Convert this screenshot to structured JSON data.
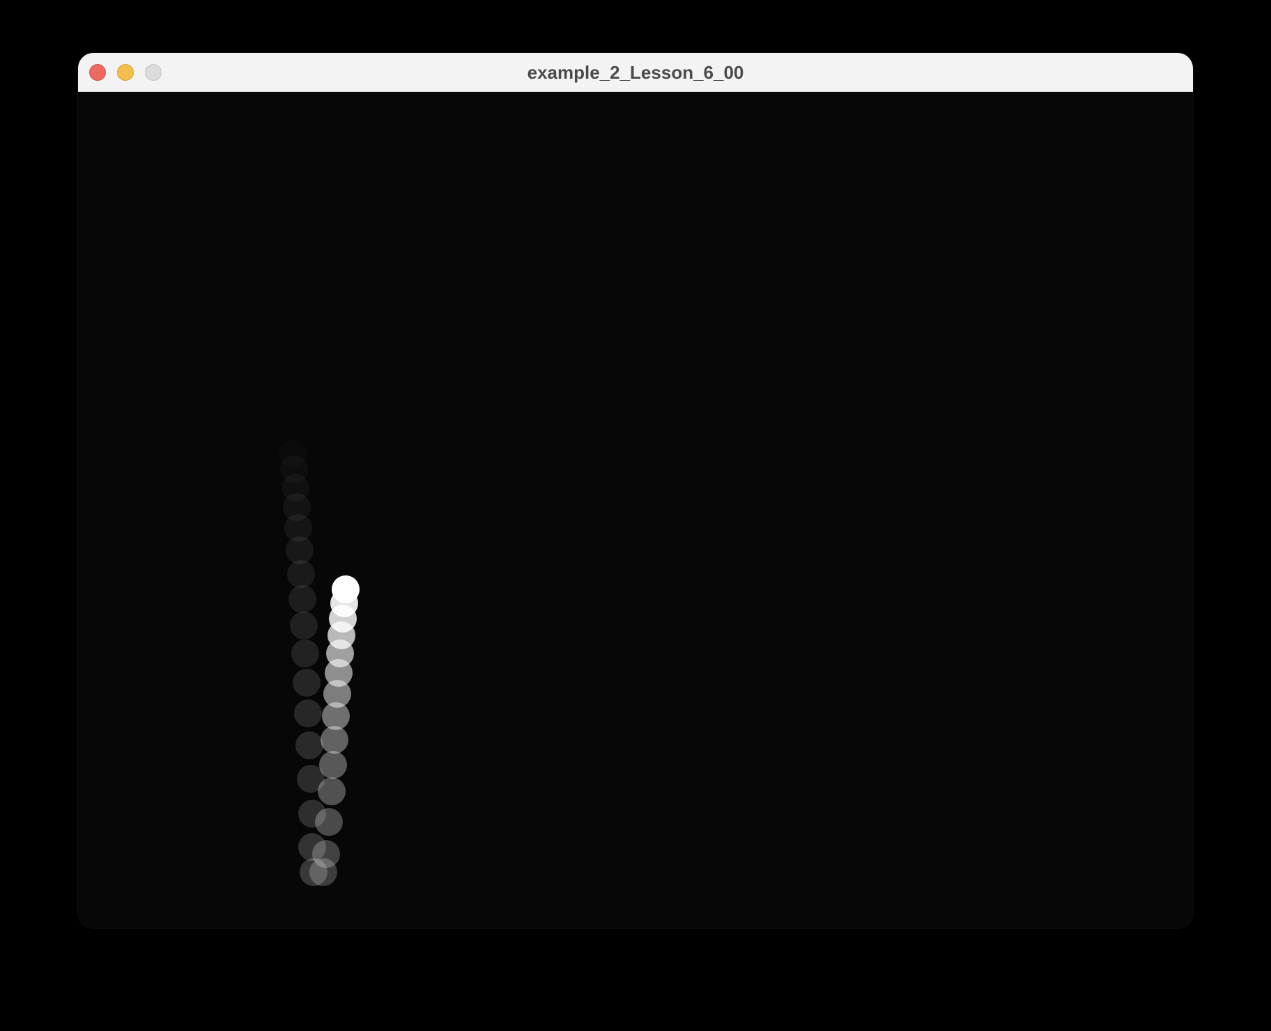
{
  "window": {
    "title": "example_2_Lesson_6_00"
  },
  "titlebar_buttons": [
    "close",
    "minimize",
    "zoom"
  ],
  "colors": {
    "canvas_background": "#070707",
    "titlebar_background": "#f2f3f2",
    "title_text": "#4a4a4a",
    "close": "#ec6a5f",
    "minimize": "#f4be4f",
    "zoom": "#dcdcdc"
  }
}
